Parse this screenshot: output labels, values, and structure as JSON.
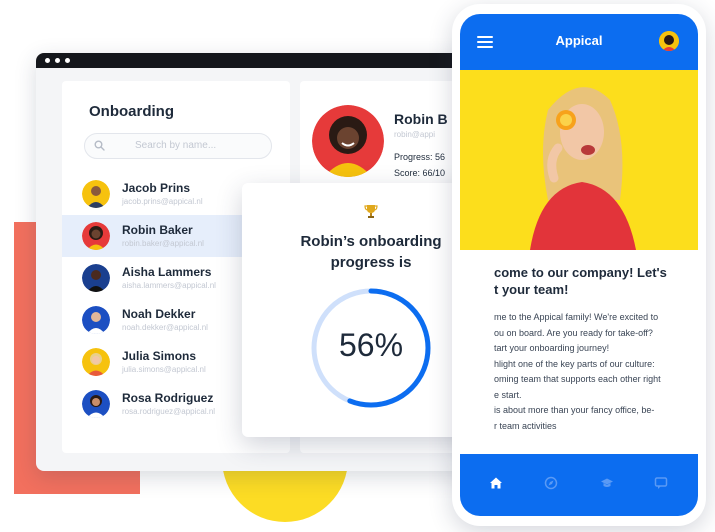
{
  "onboarding": {
    "title": "Onboarding",
    "search_placeholder": "Search by name...",
    "people": [
      {
        "name": "Jacob Prins",
        "email": "jacob.prins@appical.nl"
      },
      {
        "name": "Robin Baker",
        "email": "robin.baker@appical.nl"
      },
      {
        "name": "Aisha Lammers",
        "email": "aisha.lammers@appical.nl"
      },
      {
        "name": "Noah Dekker",
        "email": "noah.dekker@appical.nl"
      },
      {
        "name": "Julia Simons",
        "email": "julia.simons@appical.nl"
      },
      {
        "name": "Rosa Rodriguez",
        "email": "rosa.rodriguez@appical.nl"
      }
    ]
  },
  "profile": {
    "name": "Robin B",
    "email": "robin@appi",
    "progress": "Progress: 56",
    "score": "Score: 66/10"
  },
  "progress_card": {
    "title_line1": "Robin’s onboarding",
    "title_line2": "progress is",
    "value_label": "56%",
    "value_fraction": 0.56
  },
  "phone": {
    "app_title": "Appical",
    "welcome_line1": "come to our company! Let's",
    "welcome_line2": "t your team!",
    "body_lines": [
      "me to the Appical family! We're excited to",
      "ou on board. Are you ready for take-off?",
      "tart your onboarding journey!",
      "hlight one of the key parts of our culture:",
      "oming team that supports each other right",
      "e start.",
      "is about more than your fancy office, be-",
      "r team activities"
    ],
    "nav_icons": [
      "home-icon",
      "compass-icon",
      "graduation-cap-icon",
      "chat-icon"
    ]
  },
  "colors": {
    "brand_blue": "#0c6df0",
    "coral": "#f2705e",
    "yellow": "#fcdc24",
    "ring_track": "#cfe0fb",
    "ring_fill": "#0c6df0"
  }
}
